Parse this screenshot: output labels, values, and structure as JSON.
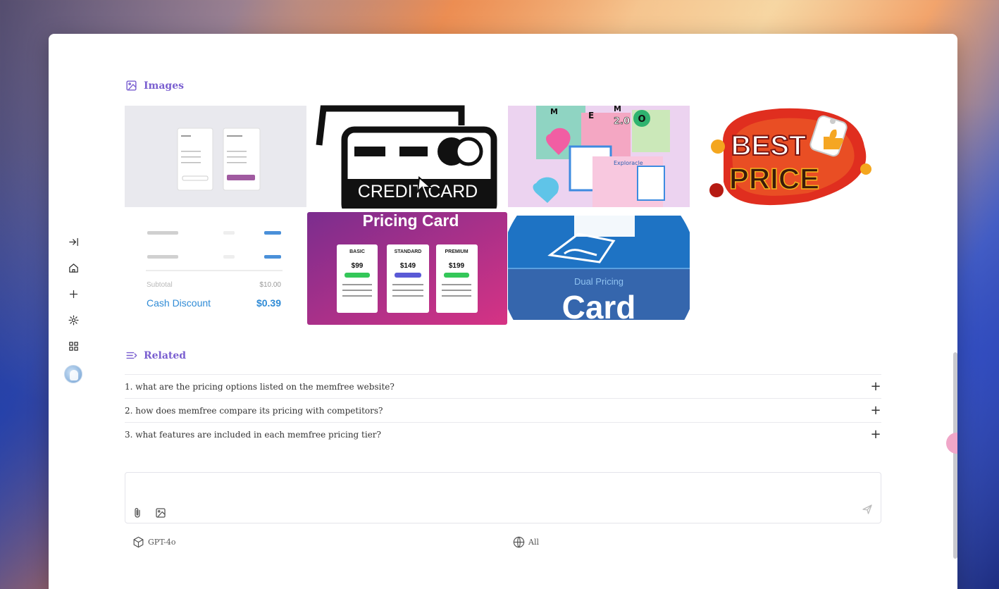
{
  "sections": {
    "images_title": "Images",
    "related_title": "Related"
  },
  "images": [
    {
      "icon": "pricing-table-thumbnail"
    },
    {
      "icon": "credit-card-icon",
      "label": "CREDIT CARD"
    },
    {
      "icon": "memo-collage-thumbnail",
      "letters": [
        "M",
        "E",
        "M",
        "O"
      ],
      "badge": "2.0",
      "caption": "Exploracle"
    },
    {
      "icon": "best-price-badge",
      "line1": "BEST",
      "line2": "PRICE"
    },
    {
      "icon": "cash-discount-receipt",
      "subtotal_label": "Subtotal",
      "subtotal_value": "$10.00",
      "discount_label": "Cash Discount",
      "discount_value": "$0.39"
    },
    {
      "icon": "pricing-card-plans",
      "title": "Pricing Card",
      "plans": [
        {
          "name": "BASIC",
          "price": "$99"
        },
        {
          "name": "STANDARD",
          "price": "$149"
        },
        {
          "name": "PREMIUM",
          "price": "$199"
        }
      ]
    },
    {
      "icon": "dual-pricing-card",
      "line1": "Dual Pricing",
      "line2": "Card"
    }
  ],
  "related": [
    "1. what are the pricing options listed on the memfree website?",
    "2. how does memfree compare its pricing with competitors?",
    "3. what features are included in each memfree pricing tier?"
  ],
  "composer": {
    "placeholder": ""
  },
  "options": {
    "model": "GPT-4o",
    "scope": "All"
  },
  "nav_icons": [
    "collapse-sidebar-icon",
    "home-icon",
    "plus-icon",
    "gear-icon",
    "grid-icon",
    "avatar"
  ],
  "colors": {
    "accent": "#7a5fd0",
    "window_bg": "#ffffff"
  }
}
